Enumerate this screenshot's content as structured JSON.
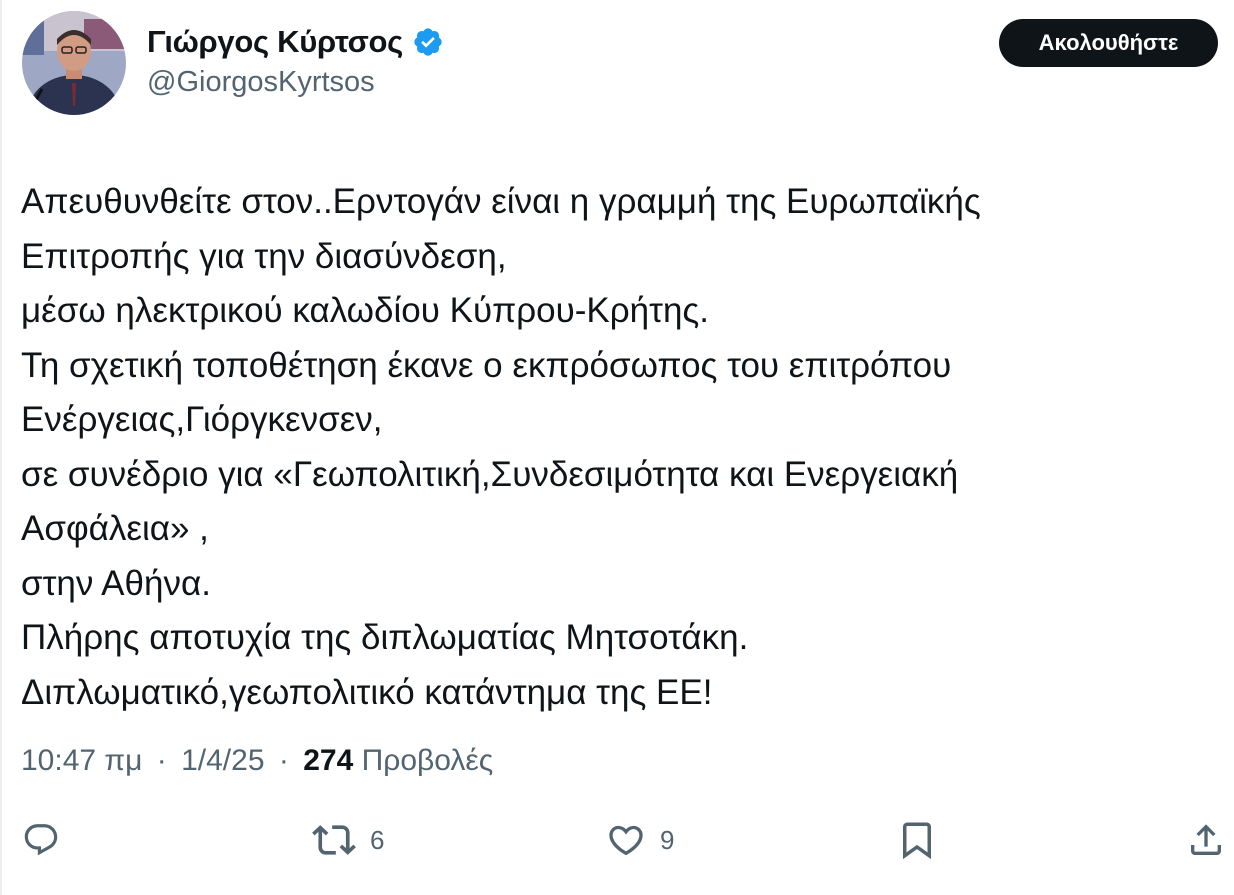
{
  "author": {
    "display_name": "Γιώργος Κύρτσος",
    "handle": "@GiorgosKyrtsos",
    "verified": true,
    "verified_color": "#1d9bf0"
  },
  "follow_button": {
    "label": "Ακολουθήστε"
  },
  "tweet": {
    "lines": [
      "Απευθυνθείτε στον..Ερντογάν είναι η γραμμή της Ευρωπαϊκής",
      "Επιτροπής για την διασύνδεση,",
      "μέσω ηλεκτρικού καλωδίου Κύπρου-Κρήτης.",
      "Τη σχετική τοποθέτηση έκανε ο εκπρόσωπος του επιτρόπου",
      "Ενέργειας,Γιόργκενσεν,",
      "σε συνέδριο για «Γεωπολιτική,Συνδεσιμότητα και Ενεργειακή",
      "Ασφάλεια» ,",
      "στην Αθήνα.",
      "Πλήρης αποτυχία της διπλωματίας Μητσοτάκη.",
      "Διπλωματικό,γεωπολιτικό κατάντημα της ΕΕ!"
    ]
  },
  "meta": {
    "time": "10:47 πμ",
    "date": "1/4/25",
    "separator": "·",
    "views_count": "274",
    "views_label": "Προβολές"
  },
  "actions": {
    "reply": {
      "icon": "reply-icon"
    },
    "retweet": {
      "icon": "retweet-icon",
      "count": "6"
    },
    "like": {
      "icon": "heart-icon",
      "count": "9"
    },
    "bookmark": {
      "icon": "bookmark-icon"
    },
    "share": {
      "icon": "share-icon"
    }
  },
  "colors": {
    "text": "#0f1419",
    "secondary": "#536471",
    "verified": "#1d9bf0",
    "follow_bg": "#0f1419"
  }
}
